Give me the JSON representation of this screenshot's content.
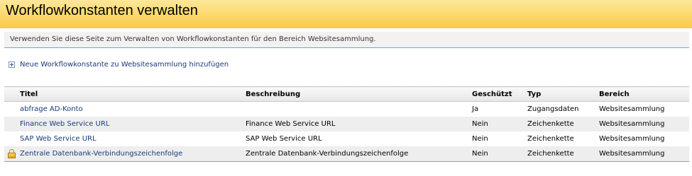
{
  "page": {
    "title": "Workflowkonstanten verwalten",
    "description": "Verwenden Sie diese Seite zum Verwalten von Workflowkonstanten für den Bereich Websitesammlung.",
    "add_link": "Neue Workflowkonstante zu Websitesammlung hinzufügen"
  },
  "table": {
    "columns": [
      "Titel",
      "Beschreibung",
      "Geschützt",
      "Typ",
      "Bereich"
    ],
    "rows": [
      {
        "title": "abfrage AD-Konto",
        "description": "",
        "protected": "Ja",
        "type": "Zugangsdaten",
        "scope": "Websitesammlung",
        "locked": false
      },
      {
        "title": "Finance Web Service URL",
        "description": "Finance Web Service URL",
        "protected": "Nein",
        "type": "Zeichenkette",
        "scope": "Websitesammlung",
        "locked": false
      },
      {
        "title": "SAP Web Service URL",
        "description": "SAP Web Service URL",
        "protected": "Nein",
        "type": "Zeichenkette",
        "scope": "Websitesammlung",
        "locked": false
      },
      {
        "title": "Zentrale Datenbank-Verbindungszeichenfolge",
        "description": "Zentrale Datenbank-Verbindungszeichenfolge",
        "protected": "Nein",
        "type": "Zeichenkette",
        "scope": "Websitesammlung",
        "locked": true
      }
    ]
  },
  "icons": {
    "add": "plus-box-icon",
    "lock": "lock-icon"
  },
  "colors": {
    "header_bg": "#fcd86a",
    "link": "#1a3b7a",
    "divider": "#7fa1c4",
    "row_alt": "#eeeeee"
  }
}
